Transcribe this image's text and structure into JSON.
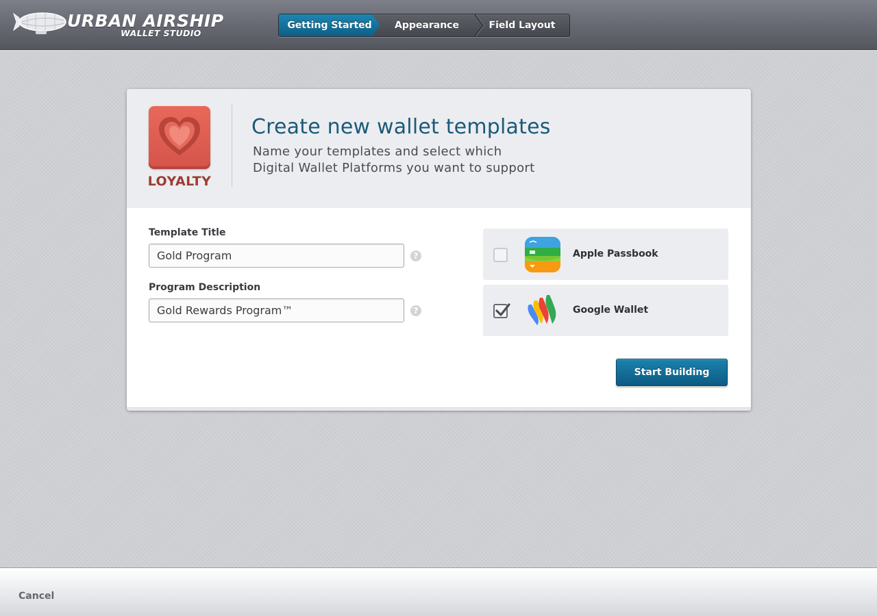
{
  "header": {
    "brand": "URBAN AIRSHIP",
    "product": "WALLET STUDIO",
    "logo_icon": "blimp-icon",
    "steps": [
      {
        "label": "Getting Started",
        "active": true
      },
      {
        "label": "Appearance",
        "active": false
      },
      {
        "label": "Field Layout",
        "active": false
      }
    ]
  },
  "card": {
    "badge": {
      "icon": "heart-icon",
      "label": "LOYALTY",
      "color": "#e0604f"
    },
    "title": "Create new wallet templates",
    "subtitle_line1": "Name your templates and select which",
    "subtitle_line2": "Digital Wallet Platforms you want to support",
    "fields": [
      {
        "label": "Template Title",
        "value": "Gold Program",
        "help": "?"
      },
      {
        "label": "Program Description",
        "value": "Gold Rewards Program™",
        "help": "?"
      }
    ],
    "platforms": [
      {
        "name": "Apple Passbook",
        "icon": "passbook-icon",
        "checked": false
      },
      {
        "name": "Google Wallet",
        "icon": "google-wallet-icon",
        "checked": true
      }
    ],
    "submit_label": "Start Building"
  },
  "footer": {
    "cancel_label": "Cancel"
  },
  "colors": {
    "accent": "#0f6690",
    "title": "#1b5a79",
    "header_bg": "#6a6c75",
    "page_bg": "#cfd0d3"
  }
}
